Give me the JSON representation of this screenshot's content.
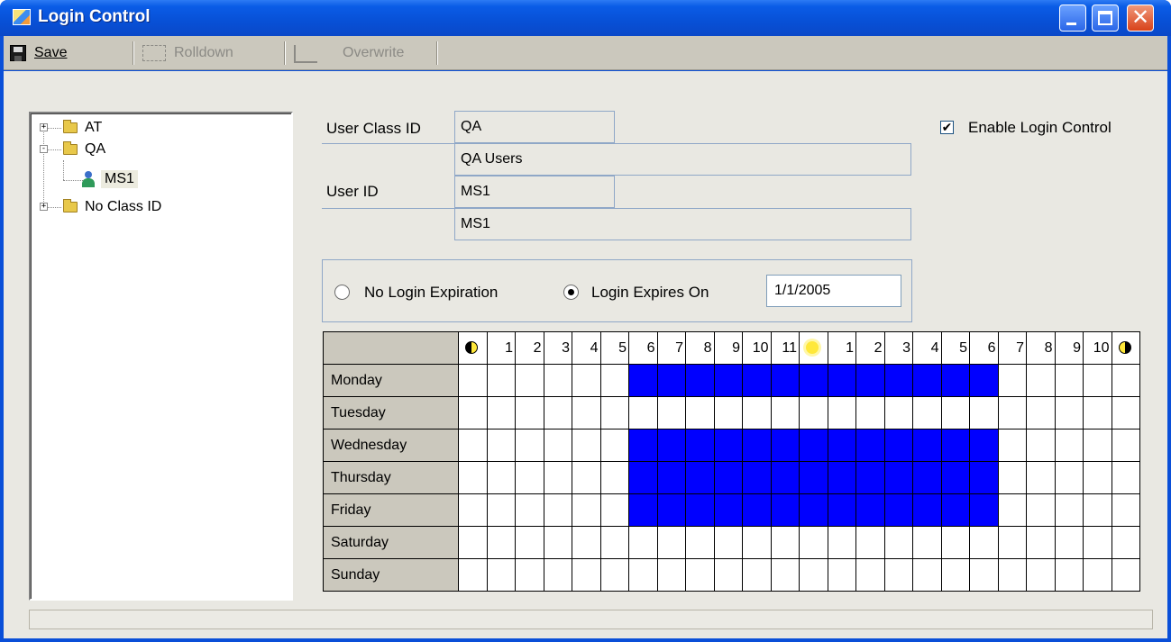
{
  "window": {
    "title": "Login Control"
  },
  "toolbar": {
    "save": "Save",
    "rolldown": "Rolldown",
    "overwrite": "Overwrite"
  },
  "tree": {
    "items": [
      {
        "label": "AT",
        "expander": "+"
      },
      {
        "label": "QA",
        "expander": "-"
      },
      {
        "label": "MS1"
      },
      {
        "label": "No Class ID",
        "expander": "+"
      }
    ]
  },
  "form": {
    "user_class_id_label": "User Class ID",
    "user_class_id": "QA",
    "user_class_name": "QA Users",
    "user_id_label": "User ID",
    "user_id": "MS1",
    "user_name": "MS1",
    "enable_login_control_label": "Enable Login Control",
    "enable_login_control_checked": true
  },
  "expiration": {
    "no_expiration_label": "No Login Expiration",
    "expires_on_label": "Login Expires On",
    "selected": "expires_on",
    "date": "1/1/2005"
  },
  "schedule": {
    "hour_labels": [
      "",
      "1",
      "2",
      "3",
      "4",
      "5",
      "6",
      "7",
      "8",
      "9",
      "10",
      "11",
      "",
      "1",
      "2",
      "3",
      "4",
      "5",
      "6",
      "7",
      "8",
      "9",
      "10",
      ""
    ],
    "header_icons": {
      "0": "moon-icon",
      "12": "sun-icon",
      "23": "moon-icon"
    },
    "days": [
      {
        "name": "Monday",
        "allowed_hours": [
          6,
          7,
          8,
          9,
          10,
          11,
          12,
          13,
          14,
          15,
          16,
          17,
          18
        ]
      },
      {
        "name": "Tuesday",
        "allowed_hours": []
      },
      {
        "name": "Wednesday",
        "allowed_hours": [
          6,
          7,
          8,
          9,
          10,
          11,
          12,
          13,
          14,
          15,
          16,
          17,
          18
        ]
      },
      {
        "name": "Thursday",
        "allowed_hours": [
          6,
          7,
          8,
          9,
          10,
          11,
          12,
          13,
          14,
          15,
          16,
          17,
          18
        ]
      },
      {
        "name": "Friday",
        "allowed_hours": [
          6,
          7,
          8,
          9,
          10,
          11,
          12,
          13,
          14,
          15,
          16,
          17,
          18
        ]
      },
      {
        "name": "Saturday",
        "allowed_hours": []
      },
      {
        "name": "Sunday",
        "allowed_hours": []
      }
    ],
    "allowed_color": "#0000ff"
  }
}
